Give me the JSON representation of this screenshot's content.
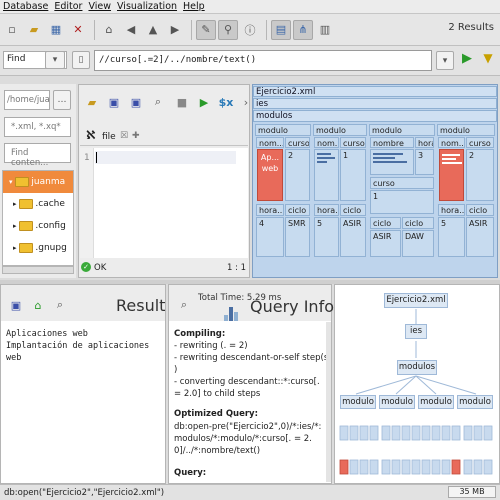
{
  "menu": [
    "Database",
    "Editor",
    "View",
    "Visualization",
    "Help"
  ],
  "toolbar": {
    "results": "2 Results"
  },
  "querybar": {
    "mode": "Find",
    "query": "//curso[.=2]/../nombre/text()"
  },
  "filebrowser": {
    "path": "/home/jua",
    "filter": "*.xml, *.xq*",
    "find_placeholder": "Find conten...",
    "items": [
      "juanma",
      ".cache",
      ".config",
      ".gnupg"
    ]
  },
  "editor": {
    "tab": "file",
    "line": "1",
    "status": "OK",
    "position": "1 : 1",
    "var_btn": "$x"
  },
  "map": {
    "title": "Ejercicio2.xml",
    "l1": "ies",
    "l2": "modulos",
    "mods": [
      {
        "name": "modulo",
        "a": "nom...",
        "b": "curso",
        "aval": "Ap... web",
        "bval": "2",
        "c": "hora...",
        "d": "ciclo",
        "cval": "4",
        "dval": "SMR",
        "hl": true
      },
      {
        "name": "modulo",
        "a": "nom...",
        "b": "curso",
        "aval": "",
        "bval": "1",
        "c": "hora...",
        "d": "ciclo",
        "cval": "5",
        "dval": "ASIR",
        "hl": false
      },
      {
        "name": "modulo",
        "a": "nombre",
        "b": "hora...",
        "aval": "",
        "bval": "3",
        "c": "curso",
        "d": "",
        "cval": "1",
        "dval": "",
        "hl": false
      },
      {
        "name": "modulo",
        "a": "nom...",
        "b": "curso",
        "aval": "",
        "bval": "2",
        "c": "hora...",
        "d": "ciclo",
        "cval": "5",
        "dval": "ASIR",
        "hl": true
      }
    ],
    "extra": {
      "ciclo1": "ciclo",
      "ciclo2": "ciclo",
      "v1": "ASIR",
      "v2": "DAW"
    }
  },
  "result": {
    "title": "Result",
    "lines": [
      "Aplicaciones web",
      "Implantación de aplicaciones",
      "web"
    ]
  },
  "queryinfo": {
    "total_time": "Total Time: 5.29 ms",
    "title": "Query Info",
    "compiling": "Compiling:",
    "steps": [
      "- rewriting (. = 2)",
      "- rewriting descendant-or-self step(s",
      ")",
      "- converting descendant::*:curso[.",
      "= 2.0] to child steps"
    ],
    "optimized": "Optimized Query:",
    "optimized_text": "db:open-pre(\"Ejercicio2\",0)/*:ies/*:modulos/*:modulo/*:curso[. = 2.0]/../*:nombre/text()",
    "query_label": "Query:"
  },
  "tree": {
    "root": "Ejercicio2.xml",
    "l1": "ies",
    "l2": "modulos",
    "children": [
      "modulo",
      "modulo",
      "modulo",
      "modulo"
    ]
  },
  "status": {
    "text": "db:open(\"Ejercicio2\",\"Ejercicio2.xml\")",
    "memory": "35 MB"
  }
}
